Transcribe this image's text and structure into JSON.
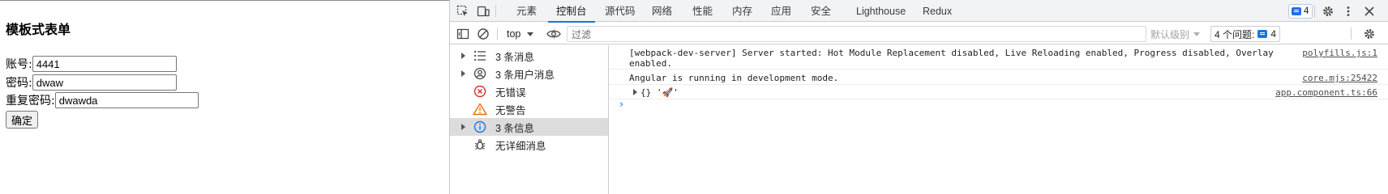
{
  "page": {
    "title": "模板式表单",
    "fields": [
      {
        "label": "账号:",
        "value": "4441"
      },
      {
        "label": "密码:",
        "value": "dwaw"
      },
      {
        "label": "重复密码:",
        "value": "dwawda"
      }
    ],
    "submit_label": "确定"
  },
  "devtools": {
    "tabs": [
      "元素",
      "控制台",
      "源代码",
      "网络",
      "性能",
      "内存",
      "应用",
      "安全",
      "Lighthouse",
      "Redux"
    ],
    "active_tab": "控制台",
    "issues_badge_count": "4",
    "toolbar": {
      "context": "top",
      "filter_placeholder": "过滤",
      "levels_label": "默认级别",
      "issues_label": "4 个问题:",
      "issues_count": "4"
    },
    "sidebar": [
      {
        "label": "3 条消息",
        "icon": "list-icon"
      },
      {
        "label": "3 条用户消息",
        "icon": "user-icon"
      },
      {
        "label": "无错误",
        "icon": "error-icon"
      },
      {
        "label": "无警告",
        "icon": "warning-icon"
      },
      {
        "label": "3 条信息",
        "icon": "info-icon"
      },
      {
        "label": "无详细消息",
        "icon": "bug-icon"
      }
    ],
    "console": [
      {
        "text": "[webpack-dev-server] Server started: Hot Module Replacement disabled, Live Reloading enabled, Progress disabled, Overlay enabled.",
        "source": "polyfills.js:1"
      },
      {
        "text": "Angular is running in development mode.",
        "source": "core.mjs:25422"
      },
      {
        "text": "{} '🚀'",
        "source": "app.component.ts:66"
      }
    ],
    "colors": {
      "accent": "#1a73e8",
      "error": "#d93025",
      "warning": "#e37400"
    }
  }
}
